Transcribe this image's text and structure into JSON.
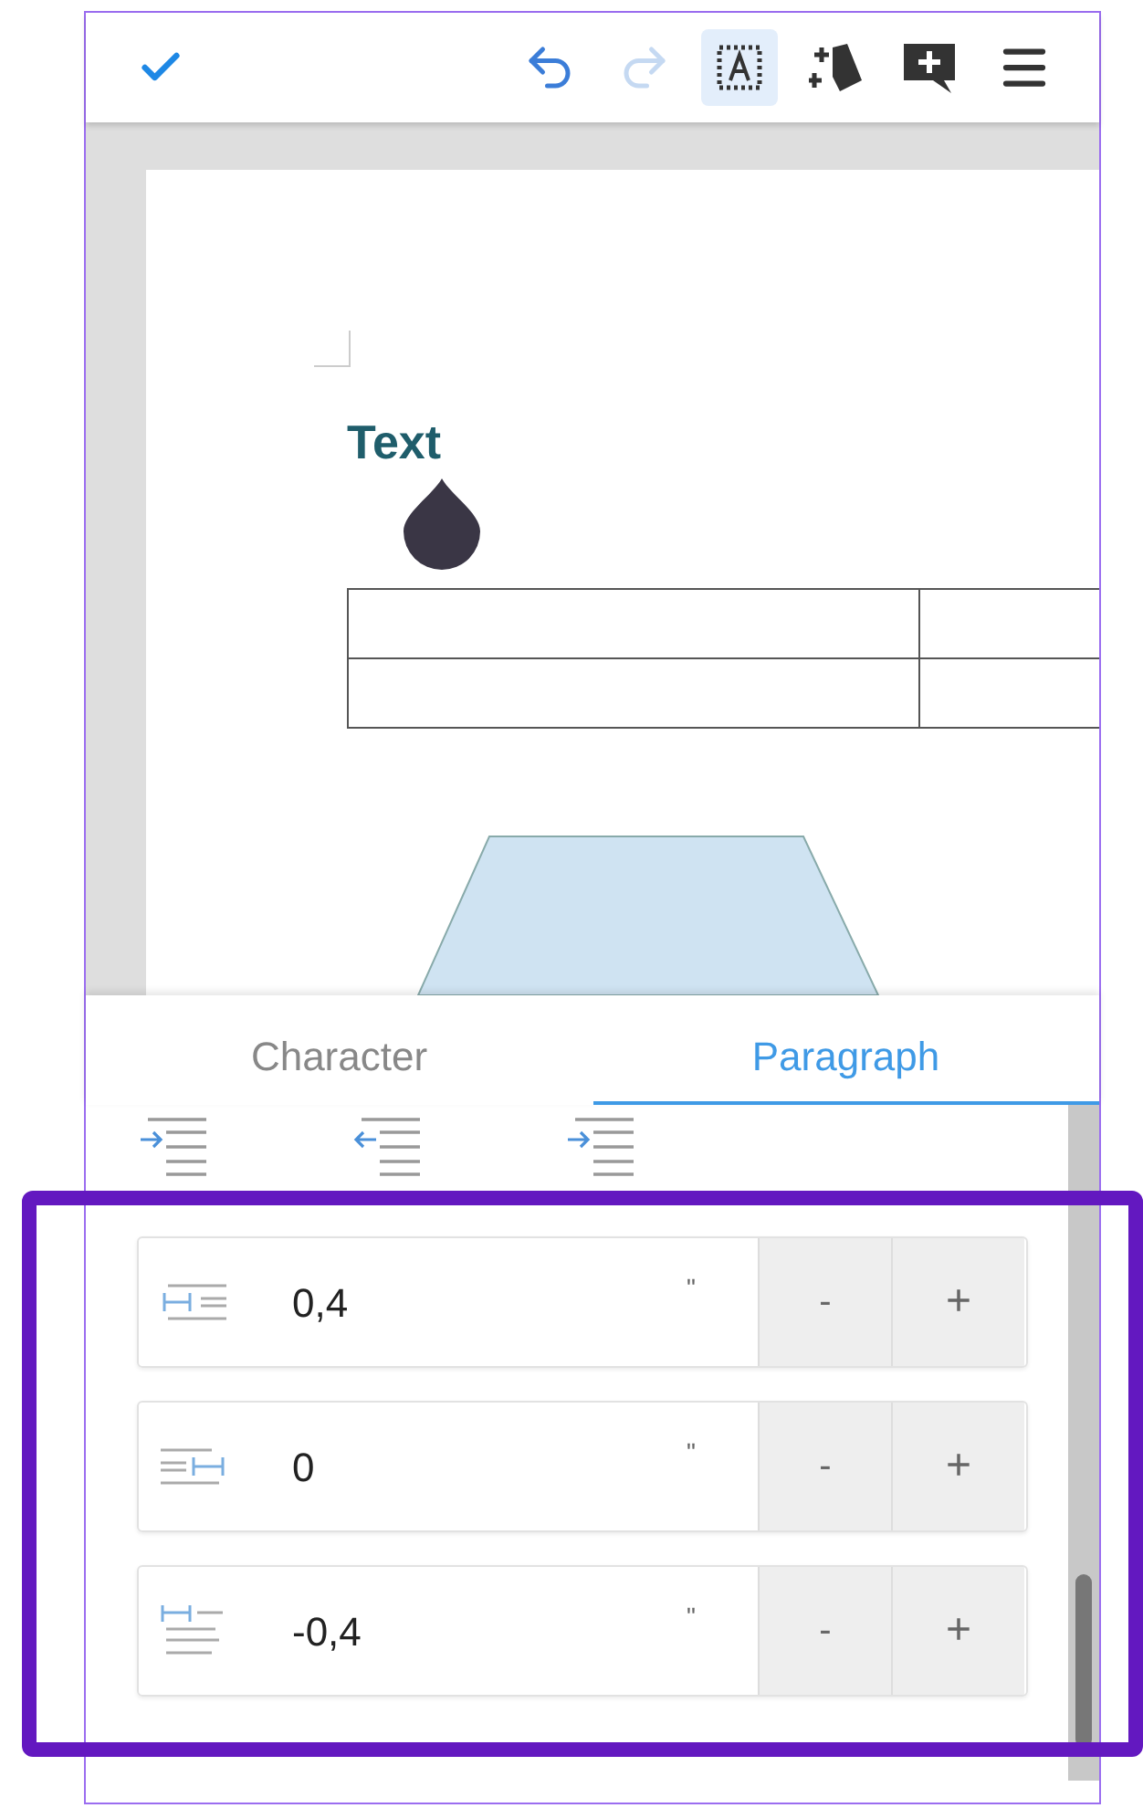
{
  "toolbar": {
    "left": [
      {
        "kind": "confirm",
        "disabled": false,
        "selected": false
      }
    ],
    "right": [
      {
        "kind": "undo",
        "disabled": false,
        "selected": false
      },
      {
        "kind": "redo",
        "disabled": true,
        "selected": false
      },
      {
        "kind": "textbox",
        "disabled": false,
        "selected": true
      },
      {
        "kind": "shape",
        "disabled": false,
        "selected": false
      },
      {
        "kind": "comment",
        "disabled": false,
        "selected": false
      },
      {
        "kind": "menu",
        "disabled": false,
        "selected": false
      }
    ]
  },
  "document": {
    "text_label": "Text"
  },
  "tabs": [
    {
      "label": "Character",
      "selected": false
    },
    {
      "label": "Paragraph",
      "selected": true
    }
  ],
  "indent_buttons": [
    {
      "kind": "increase"
    },
    {
      "kind": "decrease"
    },
    {
      "kind": "hanging"
    }
  ],
  "spinners": [
    {
      "kind": "before",
      "value": "0,4",
      "unit": "\"",
      "minus": "-",
      "plus": "+"
    },
    {
      "kind": "after",
      "value": "0",
      "unit": "\"",
      "minus": "-",
      "plus": "+"
    },
    {
      "kind": "first",
      "value": "-0,4",
      "unit": "\"",
      "minus": "-",
      "plus": "+"
    }
  ]
}
